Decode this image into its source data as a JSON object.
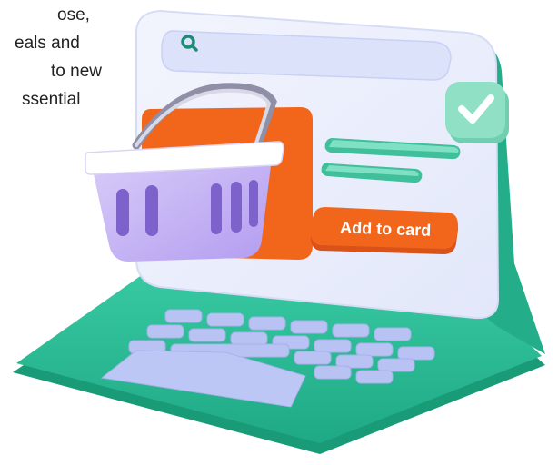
{
  "intro": {
    "lines": [
      "ose,",
      "eals and",
      "to new",
      "ssential"
    ]
  },
  "search": {
    "icon": "search-icon"
  },
  "status": {
    "icon": "checkmark-icon"
  },
  "product": {
    "cta_label": "Add to card"
  },
  "colors": {
    "laptop_base": "#2fbf99",
    "screen": "#e9edfb",
    "accent_orange": "#f2661c",
    "teal_line": "#5fd6b6",
    "check_badge": "#8fe0c4",
    "basket": "#c6b4f1",
    "keys": "#b9c3f3"
  }
}
